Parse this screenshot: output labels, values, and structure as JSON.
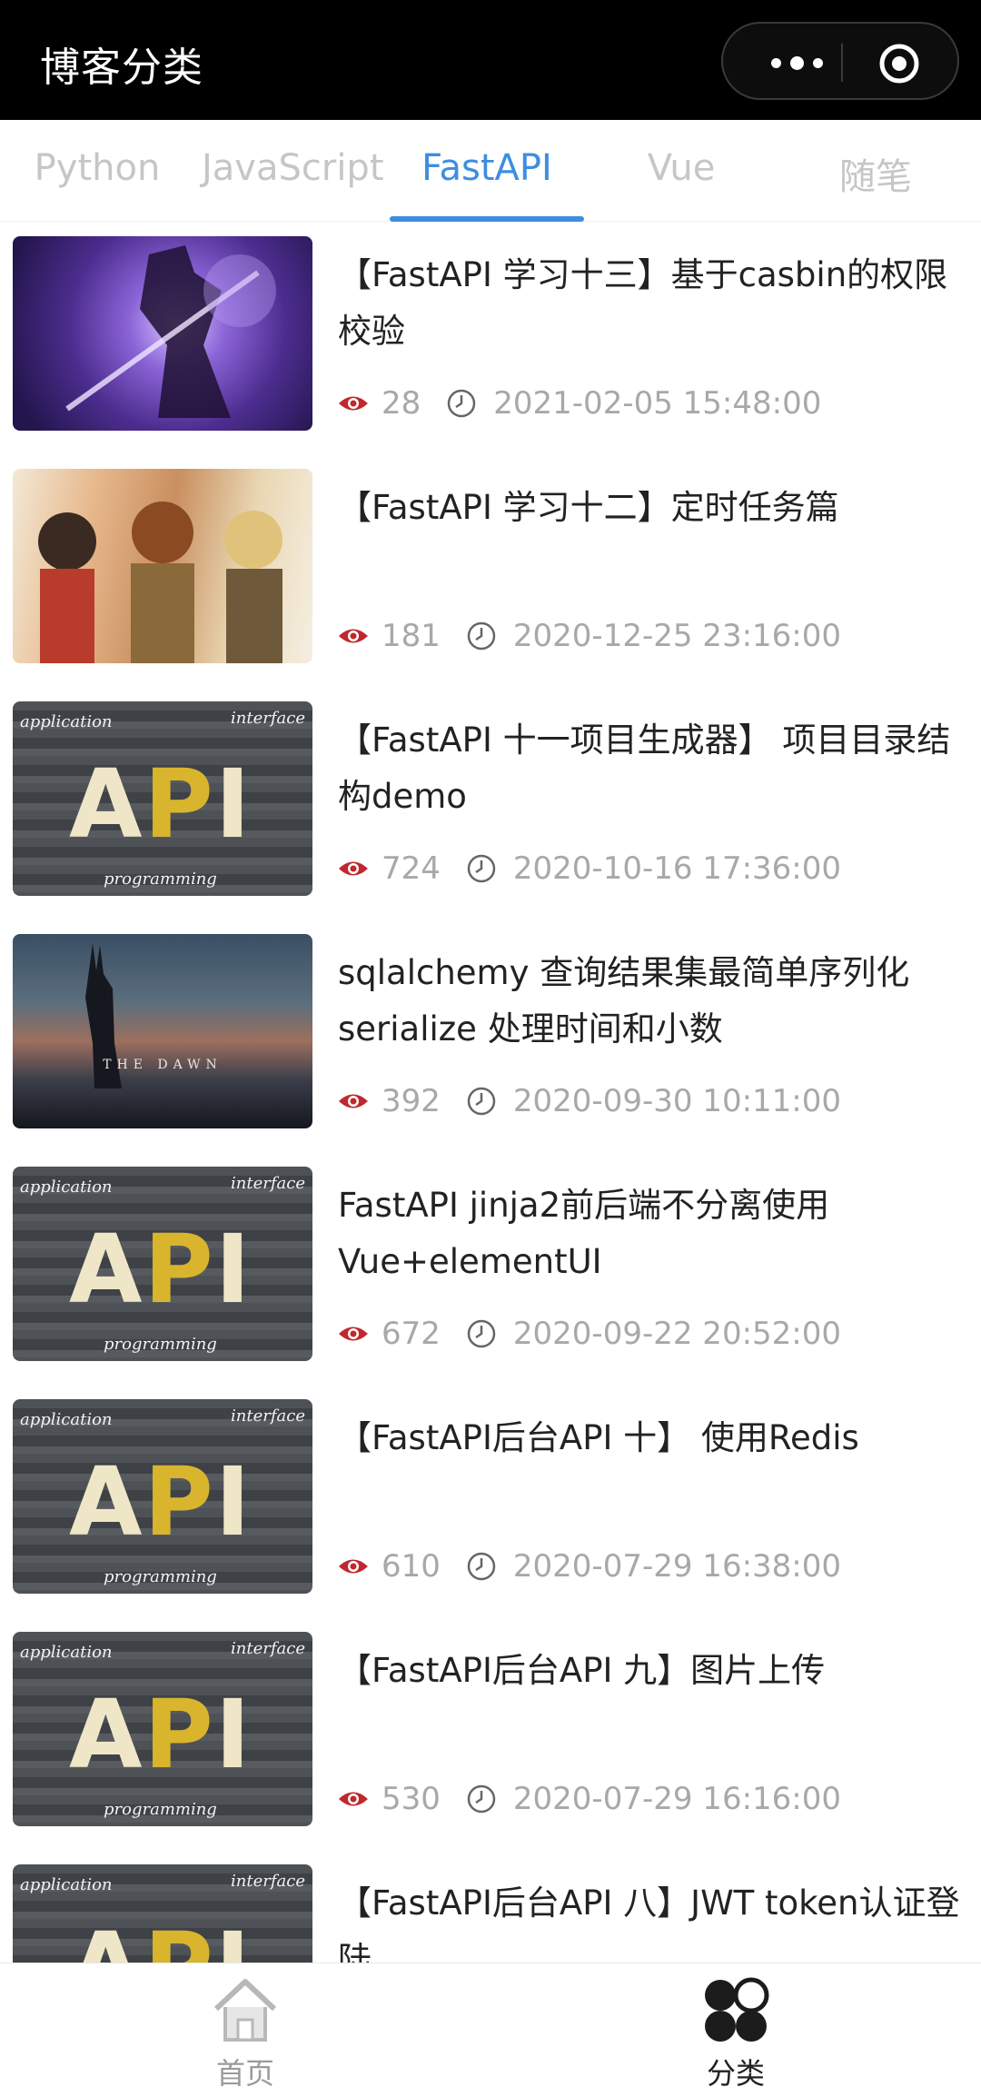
{
  "header": {
    "title": "博客分类"
  },
  "tabs": [
    {
      "label": "Python"
    },
    {
      "label": "JavaScript"
    },
    {
      "label": "FastAPI"
    },
    {
      "label": "Vue"
    },
    {
      "label": "随笔"
    }
  ],
  "active_tab": "FastAPI",
  "posts": [
    {
      "title": "【FastAPI 学习十三】基于casbin的权限校验",
      "views": "28",
      "date": "2021-02-05 15:48:00",
      "thumb": "purple-anime"
    },
    {
      "title": "【FastAPI 学习十二】定时任务篇",
      "views": "181",
      "date": "2020-12-25 23:16:00",
      "thumb": "anime-trio"
    },
    {
      "title": "【FastAPI 十一项目生成器】 项目目录结构demo",
      "views": "724",
      "date": "2020-10-16 17:36:00",
      "thumb": "api"
    },
    {
      "title": "sqlalchemy 查询结果集最简单序列化serialize 处理时间和小数",
      "views": "392",
      "date": "2020-09-30 10:11:00",
      "thumb": "the-dawn"
    },
    {
      "title": "FastAPI jinja2前后端不分离使用Vue+elementUI",
      "views": "672",
      "date": "2020-09-22 20:52:00",
      "thumb": "api"
    },
    {
      "title": "【FastAPI后台API 十】 使用Redis",
      "views": "610",
      "date": "2020-07-29 16:38:00",
      "thumb": "api"
    },
    {
      "title": "【FastAPI后台API 九】图片上传",
      "views": "530",
      "date": "2020-07-29 16:16:00",
      "thumb": "api"
    },
    {
      "title": "【FastAPI后台API 八】JWT token认证登陆",
      "views": "",
      "date": "",
      "thumb": "api"
    }
  ],
  "thumb_text": {
    "api_app": "application",
    "api_int": "interface",
    "api_prog": "programming",
    "api_big_a": "A",
    "api_big_p": "P",
    "api_big_i": "I",
    "dawn": "THE DAWN"
  },
  "bottom_nav": [
    {
      "label": "首页",
      "icon": "home-icon"
    },
    {
      "label": "分类",
      "icon": "category-icon"
    }
  ],
  "colors": {
    "accent": "#3d8ee0",
    "header_bg": "#000000",
    "eye": "#c0282d"
  }
}
